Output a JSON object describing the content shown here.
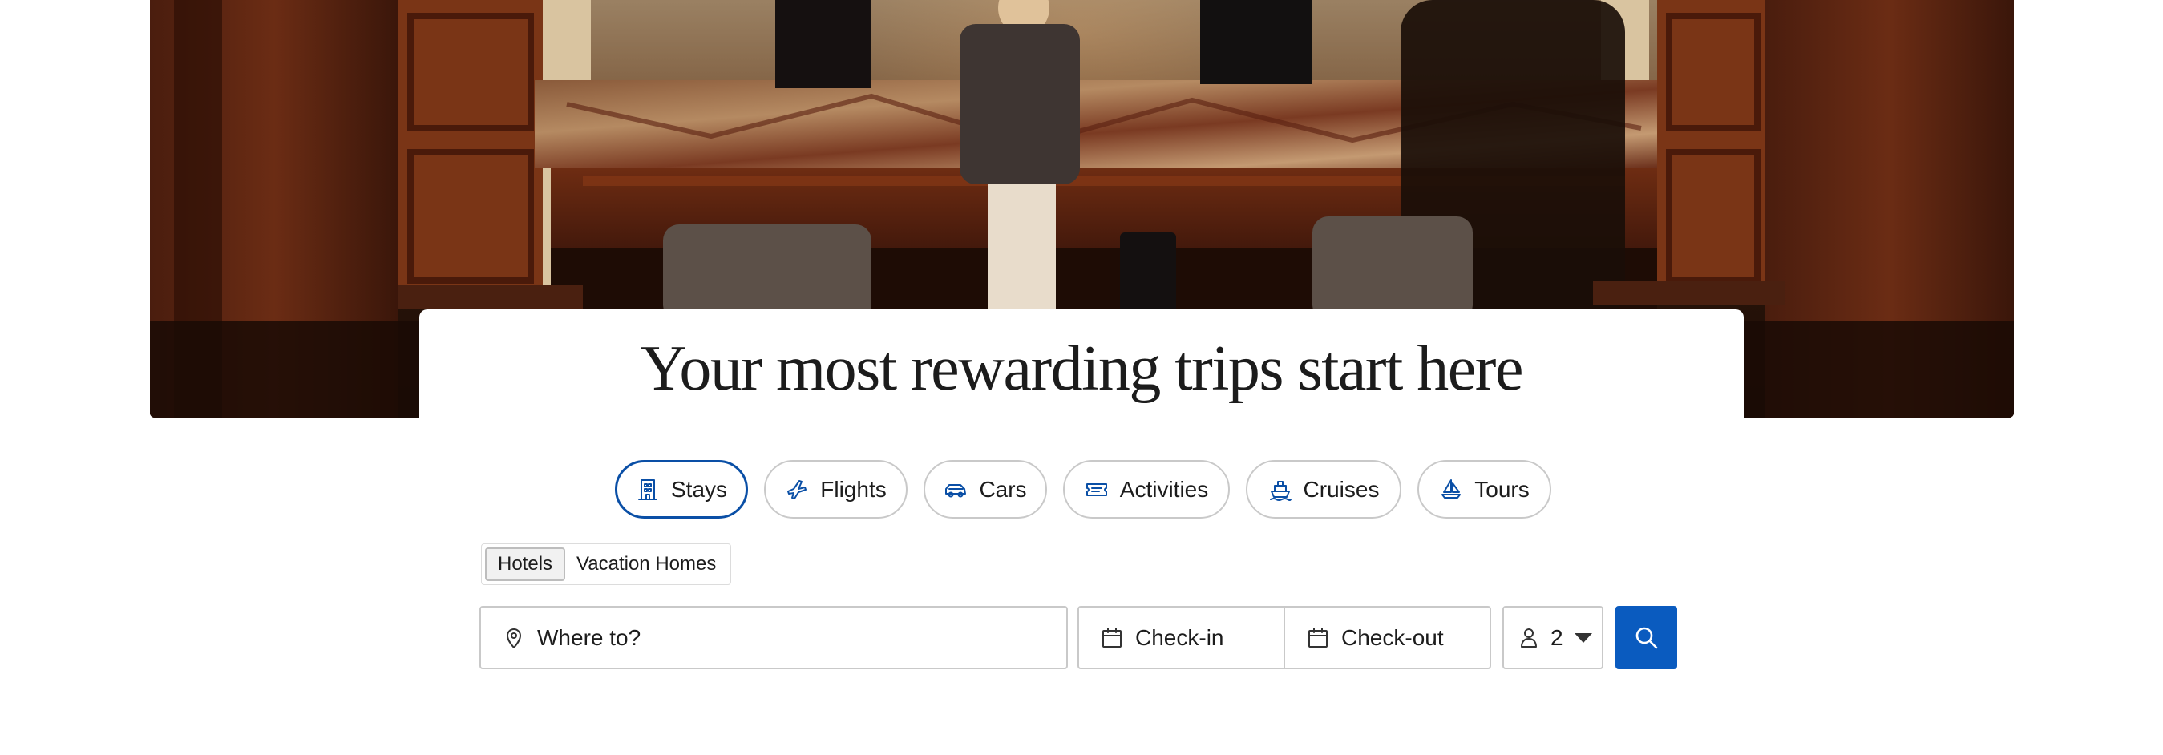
{
  "hero": {
    "headline": "Your most rewarding trips start here"
  },
  "categories": [
    {
      "label": "Stays",
      "icon": "building-icon",
      "active": true
    },
    {
      "label": "Flights",
      "icon": "plane-icon",
      "active": false
    },
    {
      "label": "Cars",
      "icon": "car-icon",
      "active": false
    },
    {
      "label": "Activities",
      "icon": "ticket-icon",
      "active": false
    },
    {
      "label": "Cruises",
      "icon": "ship-icon",
      "active": false
    },
    {
      "label": "Tours",
      "icon": "sailboat-icon",
      "active": false
    }
  ],
  "subtabs": [
    {
      "label": "Hotels",
      "active": true
    },
    {
      "label": "Vacation Homes",
      "active": false
    }
  ],
  "search": {
    "destination_placeholder": "Where to?",
    "checkin_label": "Check-in",
    "checkout_label": "Check-out",
    "guests_value": "2"
  },
  "colors": {
    "accent": "#0a4fa6",
    "search_button": "#0a5bbf"
  }
}
